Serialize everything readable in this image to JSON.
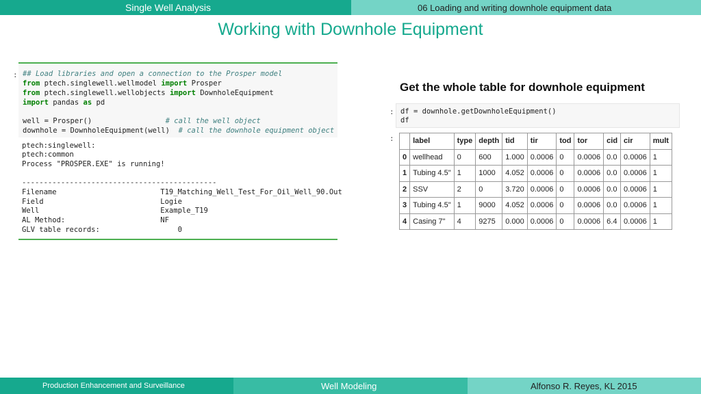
{
  "header": {
    "left": "Single Well Analysis",
    "right": "06 Loading and writing downhole equipment data"
  },
  "title": "Working with Downhole Equipment",
  "left_cell": {
    "prompt": ":",
    "code_comment1": "## Load libraries and open a connection to the Prosper model",
    "line2_kw1": "from",
    "line2_mod": "ptech.singlewell.wellmodel",
    "line2_kw2": "import",
    "line2_name": "Prosper",
    "line3_kw1": "from",
    "line3_mod": "ptech.singlewell.wellobjects",
    "line3_kw2": "import",
    "line3_name": "DownholeEquipment",
    "line4_kw1": "import",
    "line4_mod": "pandas",
    "line4_kw2": "as",
    "line4_name": "pd",
    "line6_code": "well = Prosper()                 ",
    "line6_comment": "# call the well object",
    "line7_code": "downhole = DownholeEquipment(well)  ",
    "line7_comment": "# call the downhole equipment object",
    "out1": "ptech:singlewell:",
    "out2": "ptech:common",
    "out3": "Process \"PROSPER.EXE\" is running!",
    "out4": "---------------------------------------------",
    "out5": "Filename                        T19_Matching_Well_Test_For_Oil_Well_90.Out",
    "out6": "Field                           Logie",
    "out7": "Well                            Example_T19",
    "out8": "AL Method:                      NF",
    "out9": "GLV table records:                  0"
  },
  "right_cell": {
    "heading": "Get the whole table for downhole equipment",
    "prompt1": ":",
    "code1": "df = downhole.getDownholeEquipment()",
    "code2": "df",
    "prompt2": ":",
    "columns": [
      "label",
      "type",
      "depth",
      "tid",
      "tir",
      "tod",
      "tor",
      "cid",
      "cir",
      "mult"
    ],
    "rows": [
      [
        "0",
        "wellhead",
        "0",
        "600",
        "1.000",
        "0.0006",
        "0",
        "0.0006",
        "0.0",
        "0.0006",
        "1"
      ],
      [
        "1",
        "Tubing 4.5\"",
        "1",
        "1000",
        "4.052",
        "0.0006",
        "0",
        "0.0006",
        "0.0",
        "0.0006",
        "1"
      ],
      [
        "2",
        "SSV",
        "2",
        "0",
        "3.720",
        "0.0006",
        "0",
        "0.0006",
        "0.0",
        "0.0006",
        "1"
      ],
      [
        "3",
        "Tubing 4.5\"",
        "1",
        "9000",
        "4.052",
        "0.0006",
        "0",
        "0.0006",
        "0.0",
        "0.0006",
        "1"
      ],
      [
        "4",
        "Casing 7\"",
        "4",
        "9275",
        "0.000",
        "0.0006",
        "0",
        "0.0006",
        "6.4",
        "0.0006",
        "1"
      ]
    ]
  },
  "footer": {
    "left": "Production Enhancement and Surveillance",
    "middle": "Well Modeling",
    "right": "Alfonso R. Reyes, KL 2015"
  },
  "colors": {
    "teal_dark": "#16a98e",
    "teal_mid": "#38bca4",
    "teal_light": "#74d4c6"
  }
}
